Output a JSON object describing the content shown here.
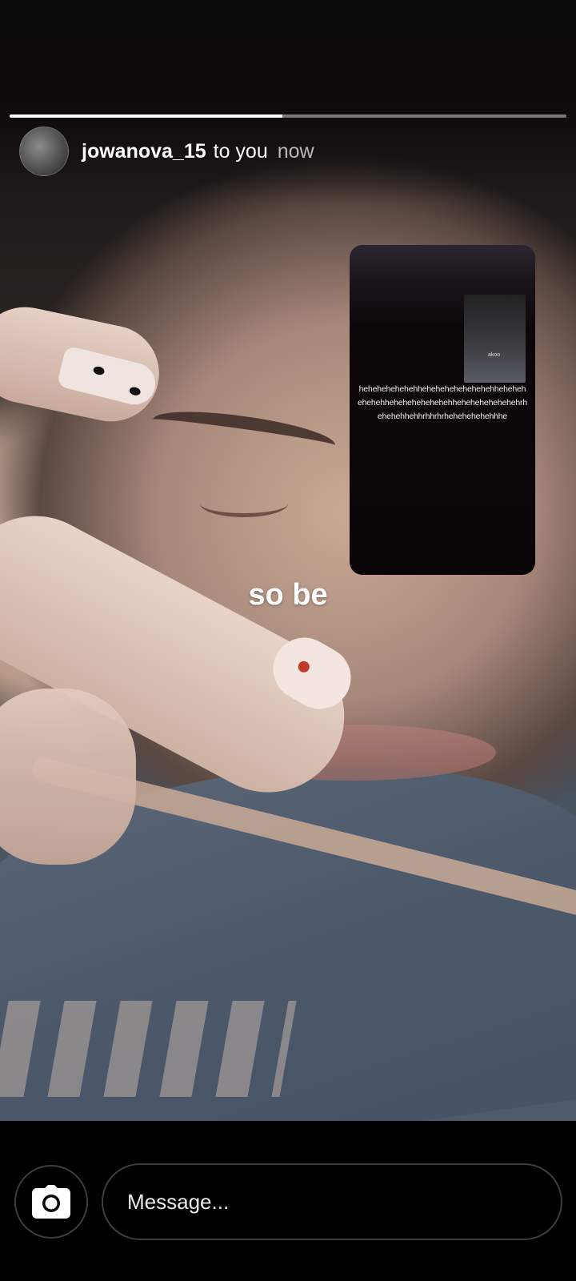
{
  "story": {
    "progress_fraction": 0.49,
    "caption": "so be",
    "embedded_card": {
      "thumb_label": "akoo",
      "text": "hehehehehehehhehehehehehehehehhehehehehehehhehehehehehehehhehehehehehehehrhehehehhehhrhhrhrhehehehehehhhe"
    }
  },
  "header": {
    "username": "jowanova_15",
    "recipient": "to you",
    "time": "now"
  },
  "composer": {
    "placeholder": "Message...",
    "camera_icon": "camera-icon"
  }
}
